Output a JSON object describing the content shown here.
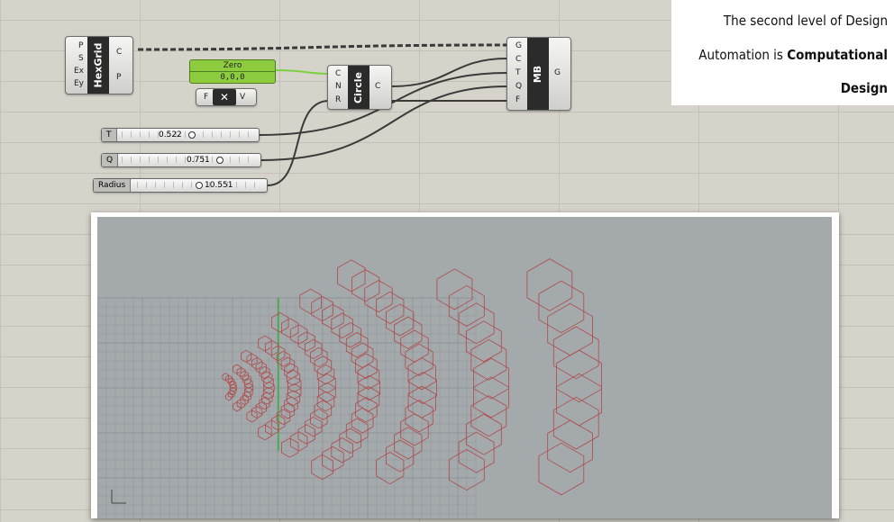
{
  "components": {
    "hexgrid": {
      "title": "HexGrid",
      "inputs": [
        "P",
        "S",
        "Ex",
        "Ey"
      ],
      "outputs": [
        "C",
        "P"
      ]
    },
    "zero": {
      "title": "Zero",
      "value": "0,0,0"
    },
    "swap": {
      "inputs": [
        "F"
      ],
      "outputs": [
        "V"
      ],
      "symbol": "✕"
    },
    "circle": {
      "title": "Circle",
      "inputs": [
        "C",
        "N",
        "R"
      ],
      "outputs": [
        "C"
      ]
    },
    "mb": {
      "title": "MB",
      "inputs": [
        "G",
        "C",
        "T",
        "Q",
        "F"
      ],
      "outputs": [
        "G"
      ]
    }
  },
  "sliders": [
    {
      "label": "T",
      "value": "0.522"
    },
    {
      "label": "Q",
      "value": "0.751"
    },
    {
      "label": "Radius",
      "value": "10.551"
    }
  ],
  "caption": {
    "line1": "The second level of Design",
    "line2_a": "Automation is ",
    "line2_b": "Computational",
    "line3": "Design"
  },
  "colors": {
    "mesh": "#b04a4a",
    "grid": "#8e9398",
    "axis_y": "#3cb043",
    "wire": "#3a3a3a"
  }
}
